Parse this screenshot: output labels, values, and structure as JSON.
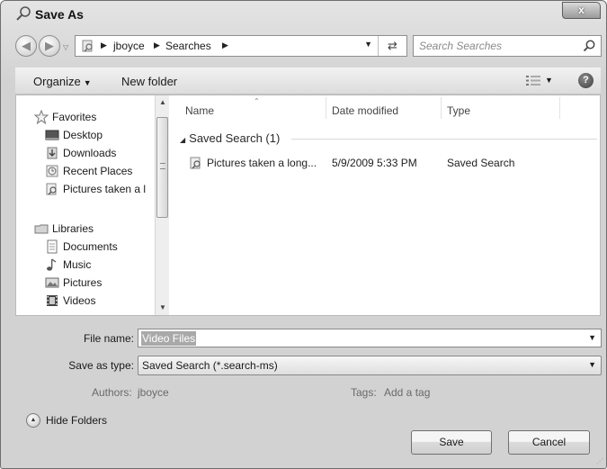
{
  "window": {
    "title": "Save As",
    "title_icon": "search-folder-icon",
    "close_label": "x"
  },
  "address_bar": {
    "crumbs": [
      "jboyce",
      "Searches"
    ],
    "refresh_icon": "refresh-icon"
  },
  "search": {
    "placeholder": "Search Searches"
  },
  "toolbar": {
    "organize_label": "Organize",
    "new_folder_label": "New folder",
    "help_label": "?"
  },
  "sidebar": {
    "favorites_label": "Favorites",
    "favorites": [
      {
        "label": "Desktop",
        "icon": "desktop-icon"
      },
      {
        "label": "Downloads",
        "icon": "downloads-icon"
      },
      {
        "label": "Recent Places",
        "icon": "recent-places-icon"
      },
      {
        "label": "Pictures taken a l",
        "icon": "saved-search-icon"
      }
    ],
    "libraries_label": "Libraries",
    "libraries": [
      {
        "label": "Documents",
        "icon": "documents-icon"
      },
      {
        "label": "Music",
        "icon": "music-icon"
      },
      {
        "label": "Pictures",
        "icon": "pictures-icon"
      },
      {
        "label": "Videos",
        "icon": "videos-icon"
      }
    ]
  },
  "file_list": {
    "columns": [
      "Name",
      "Date modified",
      "Type"
    ],
    "group_label": "Saved Search (1)",
    "rows": [
      {
        "name": "Pictures taken a long...",
        "date_modified": "5/9/2009 5:33 PM",
        "type": "Saved Search"
      }
    ]
  },
  "form": {
    "file_name_label": "File name:",
    "file_name_value": "Video Files",
    "save_as_type_label": "Save as type:",
    "save_as_type_value": "Saved Search (*.search-ms)",
    "authors_label": "Authors:",
    "authors_value": "jboyce",
    "tags_label": "Tags:",
    "tags_value": "Add a tag"
  },
  "footer": {
    "hide_folders_label": "Hide Folders",
    "save_label": "Save",
    "cancel_label": "Cancel"
  }
}
